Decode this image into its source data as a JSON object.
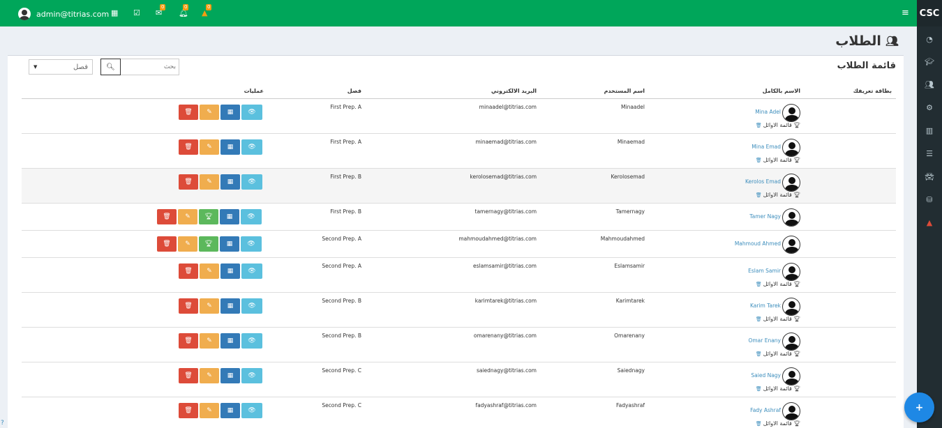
{
  "topbar": {
    "user_email": "admin@titrias.com",
    "brand": "CSC",
    "messages_count": "0",
    "notifications_count": "0",
    "warnings_count": "0",
    "icons": [
      "calendar-icon",
      "check-square-icon",
      "envelope-icon",
      "bell-icon",
      "warning-icon",
      "menu-icon"
    ]
  },
  "sidebar": {
    "icons": [
      "dashboard-icon",
      "graduation-cap-icon",
      "users-icon",
      "gear-icon",
      "bar-chart-icon",
      "list-icon",
      "car-icon",
      "database-icon",
      "warning-icon"
    ]
  },
  "page": {
    "title": "الطلاب",
    "box_title": "قائمة الطلاب",
    "search_placeholder": "بحث",
    "class_select": "فصل"
  },
  "table": {
    "headers": {
      "id_card": "بطاقة تعريفك",
      "full_name": "الاسم بالكامل",
      "username": "اسم المستخدم",
      "email": "البريد الالكتروني",
      "class": "فصل",
      "operations": "عمليات"
    },
    "leaders_label": "قائمة الاوائل",
    "rows": [
      {
        "name": "Mina Adel",
        "username": "Minaadel",
        "email": "minaadel@titrias.com",
        "class": "First Prep. A",
        "leaders": true,
        "trophy": false
      },
      {
        "name": "Mina Emad",
        "username": "Minaemad",
        "email": "minaemad@titrias.com",
        "class": "First Prep. A",
        "leaders": true,
        "trophy": false
      },
      {
        "name": "Kerolos Emad",
        "username": "Kerolosemad",
        "email": "kerolosemad@titrias.com",
        "class": "First Prep. B",
        "leaders": true,
        "trophy": false
      },
      {
        "name": "Tamer Nagy",
        "username": "Tamernagy",
        "email": "tamernagy@titrias.com",
        "class": "First Prep. B",
        "leaders": false,
        "trophy": true
      },
      {
        "name": "Mahmoud Ahmed",
        "username": "Mahmoudahmed",
        "email": "mahmoudahmed@titrias.com",
        "class": "Second Prep. A",
        "leaders": false,
        "trophy": true
      },
      {
        "name": "Eslam Samir",
        "username": "Eslamsamir",
        "email": "eslamsamir@titrias.com",
        "class": "Second Prep. A",
        "leaders": true,
        "trophy": false
      },
      {
        "name": "Karim Tarek",
        "username": "Karimtarek",
        "email": "karimtarek@titrias.com",
        "class": "Second Prep. B",
        "leaders": true,
        "trophy": false
      },
      {
        "name": "Omar Enany",
        "username": "Omarenany",
        "email": "omarenany@titrias.com",
        "class": "Second Prep. B",
        "leaders": true,
        "trophy": false
      },
      {
        "name": "Saied Nagy",
        "username": "Saiednagy",
        "email": "saiednagy@titrias.com",
        "class": "Second Prep. C",
        "leaders": true,
        "trophy": false
      },
      {
        "name": "Fady Ashraf",
        "username": "Fadyashraf",
        "email": "fadyashraf@titrias.com",
        "class": "Second Prep. C",
        "leaders": true,
        "trophy": false
      }
    ]
  },
  "fab": {
    "label": "+"
  },
  "help": {
    "label": "?"
  }
}
